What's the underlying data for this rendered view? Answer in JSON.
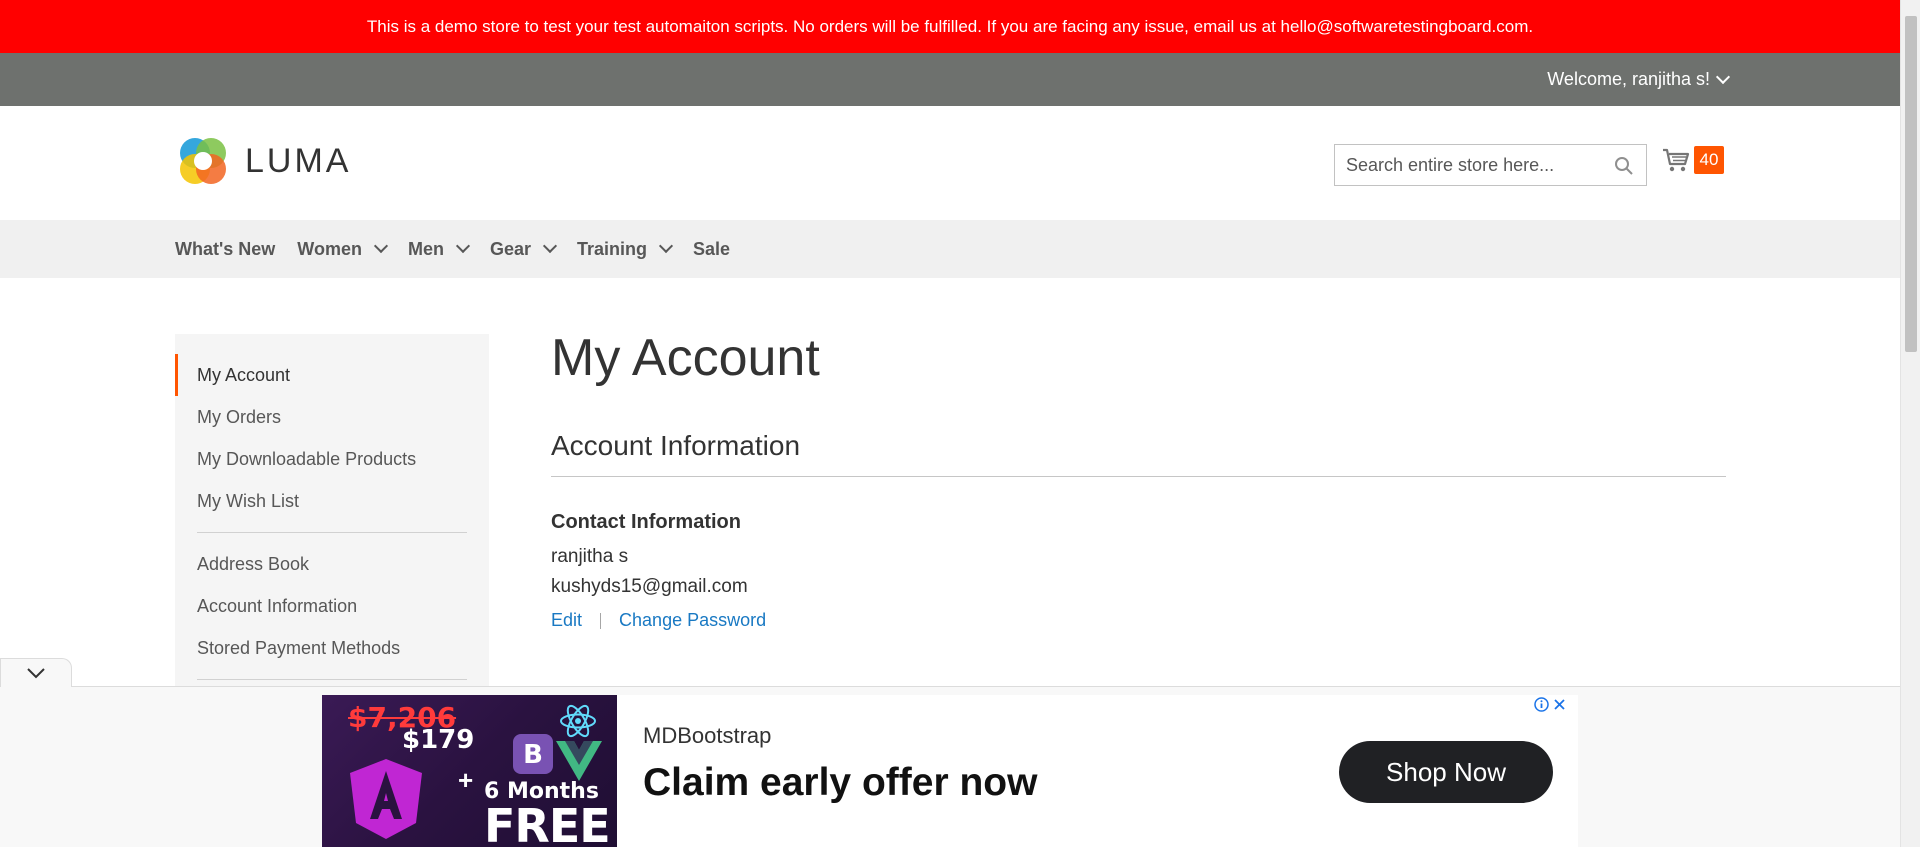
{
  "demo_banner": {
    "text": "This is a demo store to test your test automaiton scripts. No orders will be fulfilled. If you are facing any issue, email us at hello@softwaretestingboard.com."
  },
  "header_panel": {
    "welcome": "Welcome, ranjitha s!"
  },
  "header": {
    "logo_text": "LUMA",
    "search_placeholder": "Search entire store here...",
    "cart_count": "40"
  },
  "nav": {
    "items": [
      {
        "label": "What's New",
        "has_dropdown": false
      },
      {
        "label": "Women",
        "has_dropdown": true
      },
      {
        "label": "Men",
        "has_dropdown": true
      },
      {
        "label": "Gear",
        "has_dropdown": true
      },
      {
        "label": "Training",
        "has_dropdown": true
      },
      {
        "label": "Sale",
        "has_dropdown": false
      }
    ]
  },
  "sidebar": {
    "items": [
      {
        "label": "My Account"
      },
      {
        "label": "My Orders"
      },
      {
        "label": "My Downloadable Products"
      },
      {
        "label": "My Wish List"
      },
      {
        "label": "Address Book"
      },
      {
        "label": "Account Information"
      },
      {
        "label": "Stored Payment Methods"
      }
    ]
  },
  "main": {
    "page_title": "My Account",
    "section_title": "Account Information",
    "contact": {
      "title": "Contact Information",
      "name": "ranjitha s",
      "email": "kushyds15@gmail.com",
      "edit_label": "Edit",
      "change_password_label": "Change Password"
    }
  },
  "ad": {
    "old_price": "$7,206",
    "new_price": "$179",
    "plus": "+",
    "months": "6 Months",
    "free": "FREE",
    "brand": "MDBootstrap",
    "headline": "Claim early offer now",
    "cta": "Shop Now"
  },
  "colors": {
    "banner_red": "#ff0000",
    "panel_gray": "#6e716e",
    "accent_orange": "#ff5501",
    "link_blue": "#1979c3"
  }
}
